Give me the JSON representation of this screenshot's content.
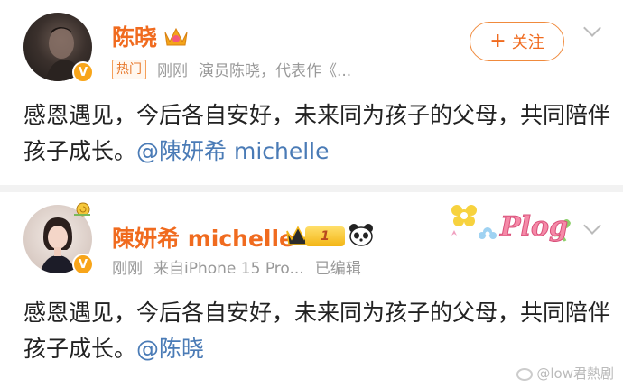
{
  "post1": {
    "author": "陈晓",
    "hot_tag": "热门",
    "time": "刚刚",
    "description": "演员陈晓，代表作《...",
    "follow_label": "关注",
    "text_before": "感恩遇见，今后各自安好，未来同为孩子的父母，共同陪伴孩子成长。",
    "mention": "@陳妍希 michelle"
  },
  "post2": {
    "author": "陳妍希 michelle",
    "level": "1",
    "time": "刚刚",
    "source": "来自iPhone 15 Pro...",
    "edited": "已编辑",
    "text_before": "感恩遇见，今后各自安好，未来同为孩子的父母，共同陪伴孩子成长。",
    "mention": "@陈晓",
    "plog": "Plog"
  },
  "watermark": "@low君熱剧",
  "colors": {
    "accent": "#f06b1f",
    "link": "#4a7bb6"
  }
}
